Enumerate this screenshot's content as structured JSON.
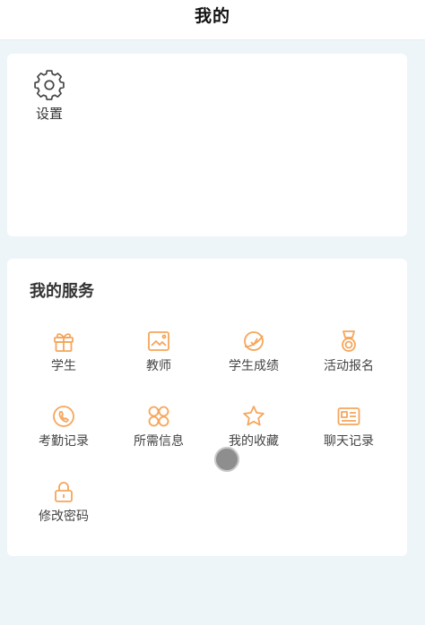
{
  "header": {
    "title": "我的"
  },
  "settings": {
    "label": "设置"
  },
  "services": {
    "heading": "我的服务",
    "items": [
      {
        "label": "学生",
        "icon": "gift-icon"
      },
      {
        "label": "教师",
        "icon": "image-icon"
      },
      {
        "label": "学生成绩",
        "icon": "planet-icon"
      },
      {
        "label": "活动报名",
        "icon": "medal-icon"
      },
      {
        "label": "考勤记录",
        "icon": "phone-icon"
      },
      {
        "label": "所需信息",
        "icon": "apps-icon"
      },
      {
        "label": "我的收藏",
        "icon": "star-icon"
      },
      {
        "label": "聊天记录",
        "icon": "id-card-icon"
      },
      {
        "label": "修改密码",
        "icon": "lock-icon"
      }
    ]
  },
  "colors": {
    "accent": "#f5a65b",
    "background": "#edf5f9"
  }
}
